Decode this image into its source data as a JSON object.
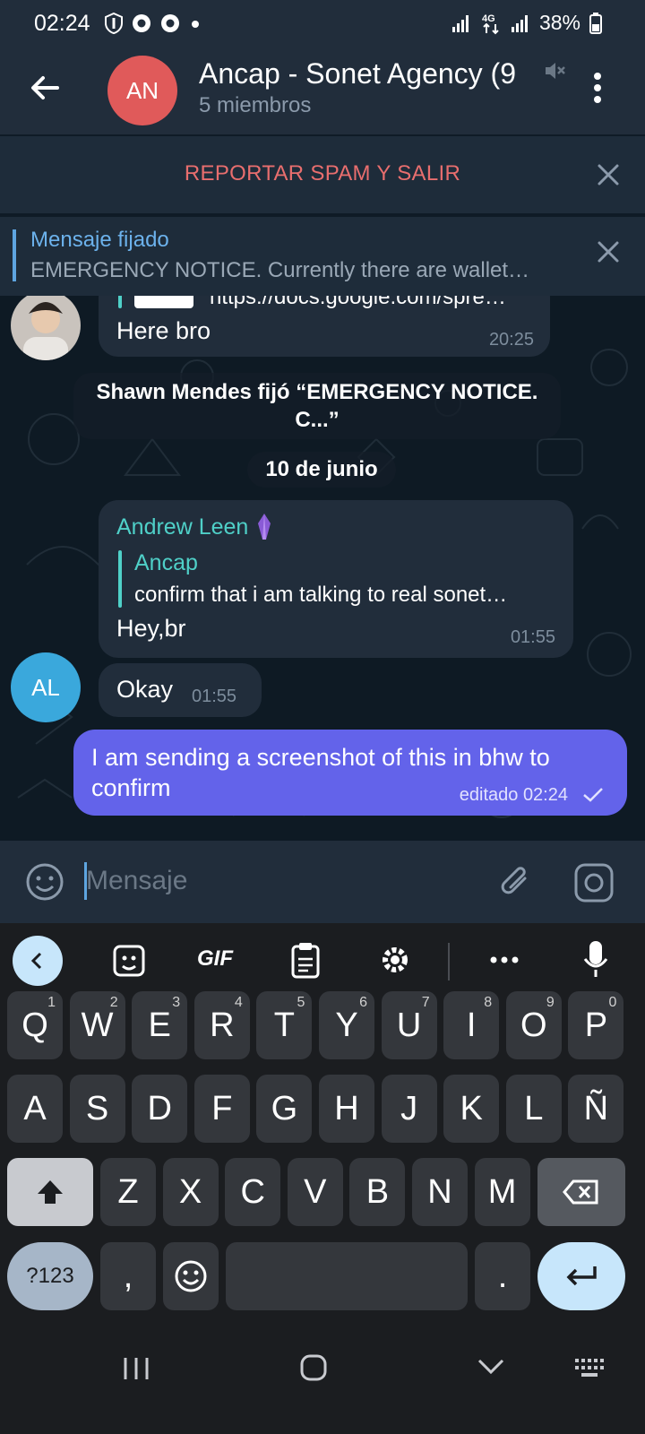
{
  "status": {
    "time": "02:24",
    "battery": "38%"
  },
  "header": {
    "avatar_initials": "AN",
    "title": "Ancap - Sonet Agency (9",
    "subtitle": "5 miembros"
  },
  "spam": {
    "label": "REPORTAR SPAM Y SALIR"
  },
  "pinned": {
    "title": "Mensaje fijado",
    "text": "EMERGENCY NOTICE.  Currently there are wallet…"
  },
  "messages": {
    "m1": {
      "link": "https://docs.google.com/spre…",
      "text": "Here bro",
      "time": "20:25"
    },
    "system": "Shawn Mendes fijó “EMERGENCY NOTICE. C...”",
    "date": "10 de junio",
    "m2": {
      "sender": "Andrew Leen",
      "quote_name": "Ancap",
      "quote_text": "confirm that i am talking to real sonet…",
      "text": "Hey,br",
      "time": "01:55"
    },
    "m3": {
      "avatar_initials": "AL",
      "text": "Okay",
      "time": "01:55"
    },
    "m4": {
      "text": "I am sending a screenshot of this in bhw to confirm",
      "time": "editado 02:24"
    }
  },
  "input": {
    "placeholder": "Mensaje"
  },
  "keyboard": {
    "gif": "GIF",
    "row1": [
      [
        "Q",
        "1"
      ],
      [
        "W",
        "2"
      ],
      [
        "E",
        "3"
      ],
      [
        "R",
        "4"
      ],
      [
        "T",
        "5"
      ],
      [
        "Y",
        "6"
      ],
      [
        "U",
        "7"
      ],
      [
        "I",
        "8"
      ],
      [
        "O",
        "9"
      ],
      [
        "P",
        "0"
      ]
    ],
    "row2": [
      "A",
      "S",
      "D",
      "F",
      "G",
      "H",
      "J",
      "K",
      "L",
      "Ñ"
    ],
    "row3": [
      "Z",
      "X",
      "C",
      "V",
      "B",
      "N",
      "M"
    ],
    "sym": "?123",
    "comma": ",",
    "period": "."
  },
  "colors": {
    "accent": "#5ea5e0",
    "outgoing": "#6363ea",
    "spam": "#e86e6e",
    "avatar_an": "#e05a5a",
    "avatar_al": "#3aa8dc"
  }
}
